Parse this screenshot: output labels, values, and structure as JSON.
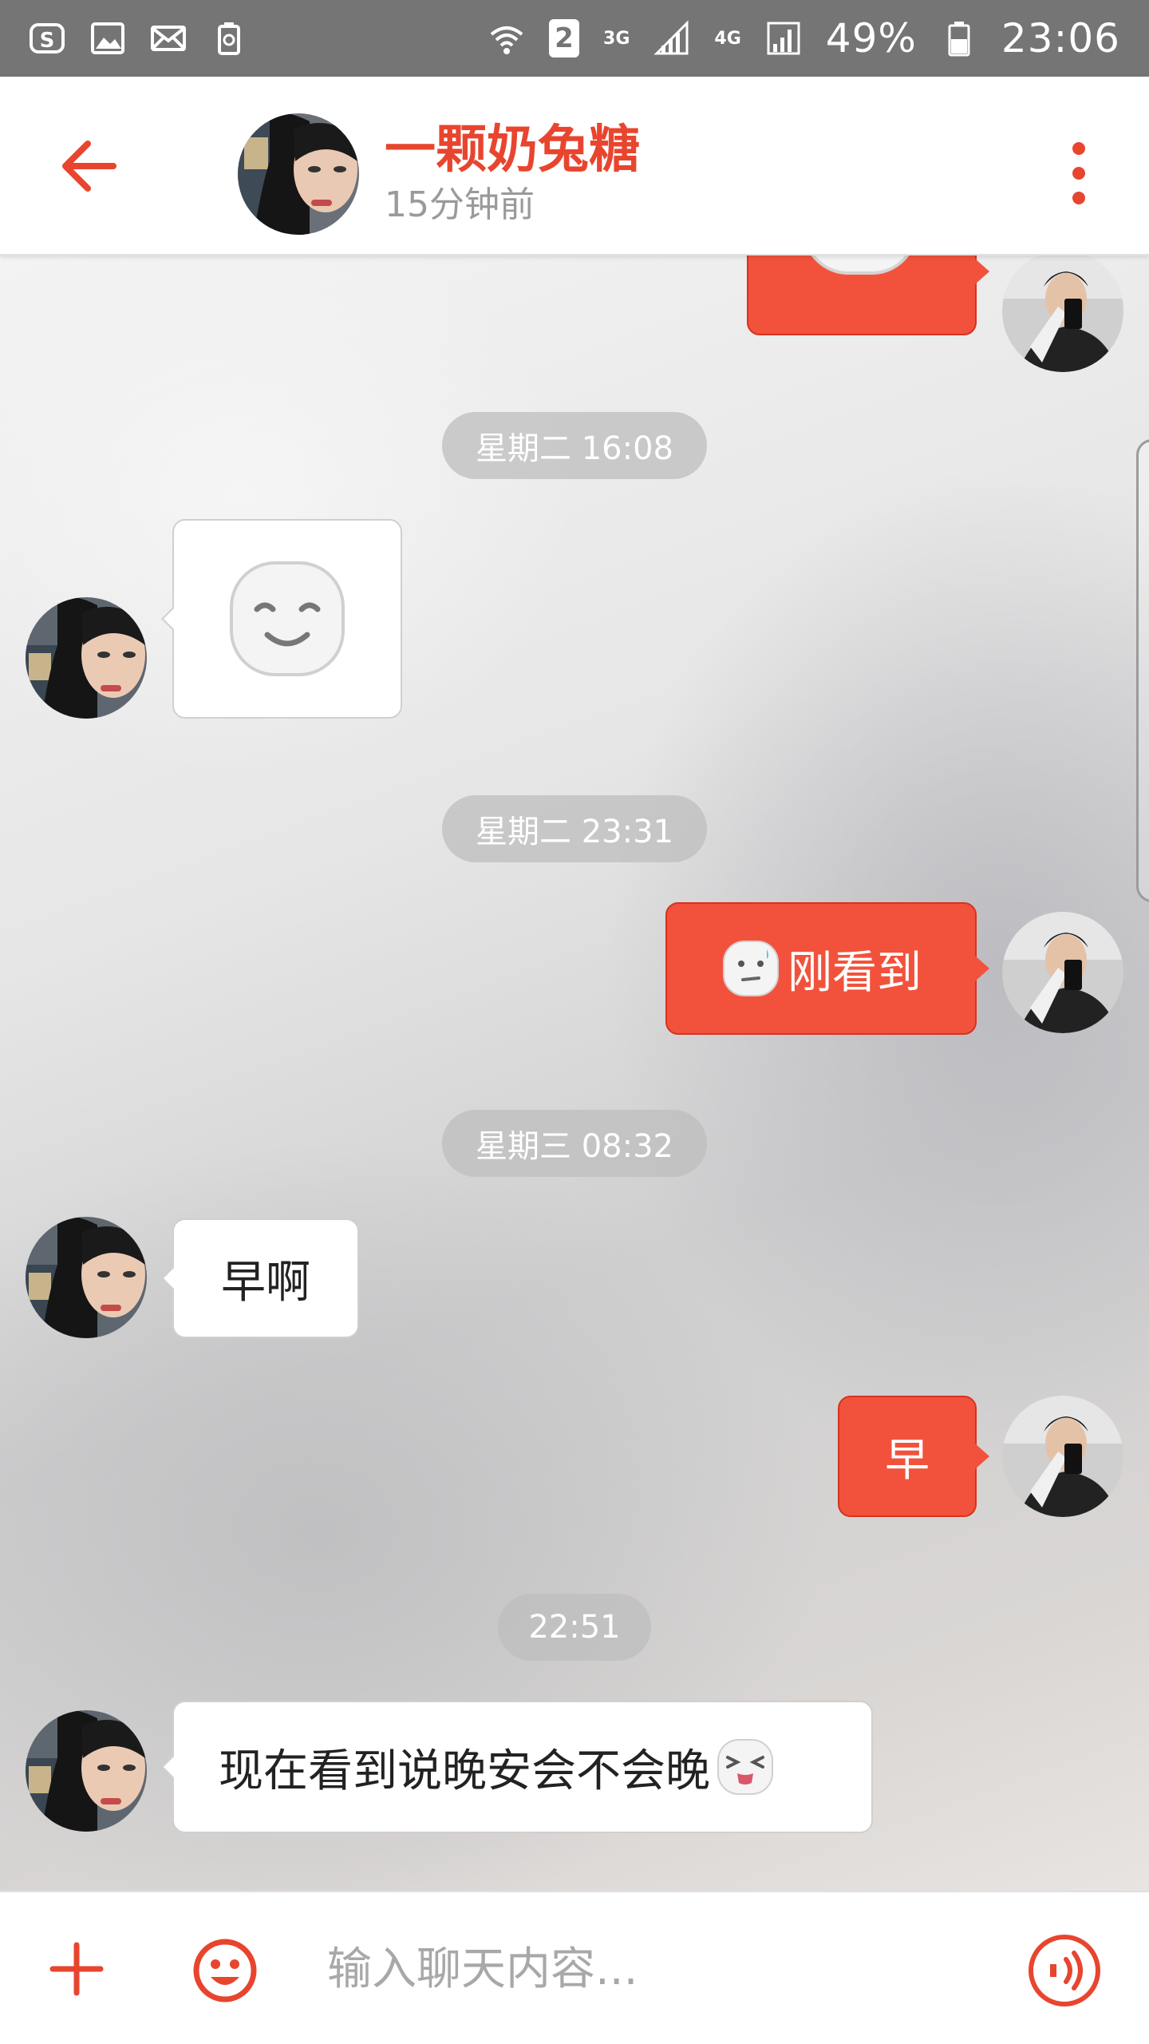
{
  "status_bar": {
    "sim_slot": "2",
    "network_1": "3G",
    "network_2": "4G",
    "battery": "49%",
    "time": "23:06",
    "icons": [
      "sogou-icon",
      "gallery-icon",
      "mail-icon",
      "battery-saver-icon",
      "wifi-icon",
      "signal-icon",
      "battery-icon"
    ]
  },
  "header": {
    "contact_name": "一颗奶兔糖",
    "last_seen": "15分钟前",
    "icons": [
      "back-arrow-icon",
      "more-vertical-icon"
    ]
  },
  "chat": {
    "timestamps": [
      "星期二 16:08",
      "星期二 23:31",
      "星期三 08:32",
      "22:51"
    ],
    "messages": [
      {
        "side": "out",
        "type": "emoji",
        "emoji": "smile-emoji"
      },
      {
        "side": "in",
        "type": "emoji",
        "emoji": "smile-emoji"
      },
      {
        "side": "out",
        "type": "text",
        "emoji": "awkward-emoji",
        "text": "刚看到"
      },
      {
        "side": "in",
        "type": "text",
        "text": "早啊"
      },
      {
        "side": "out",
        "type": "text",
        "text": "早"
      },
      {
        "side": "in",
        "type": "text",
        "text": "现在看到说晚安会不会晚",
        "emoji": "squint-tongue-emoji"
      }
    ]
  },
  "input": {
    "placeholder": "输入聊天内容..."
  },
  "colors": {
    "accent": "#e8452f",
    "outgoing_bubble": "#f2523c",
    "incoming_bubble": "#ffffff",
    "status_bar": "#757575"
  }
}
